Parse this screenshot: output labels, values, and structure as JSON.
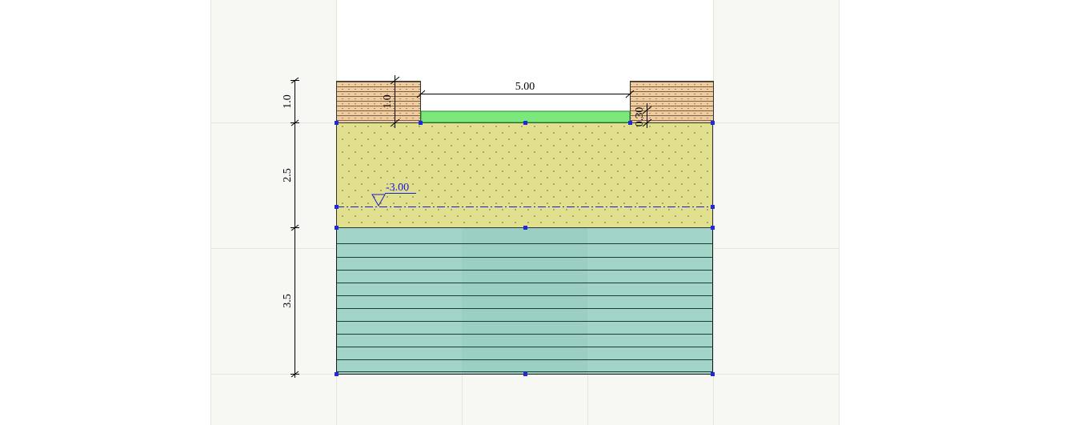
{
  "colors": {
    "page_bg": "#ffffff",
    "workspace_bg": "#f7f7f3",
    "grid_line": "#e6e6e0",
    "top_soil": "#f1cc9e",
    "middle_soil": "#e1e08e",
    "bottom_soil": "#a2d4c7",
    "water_in_trench": "#7be87b",
    "handle": "#1f2bd8",
    "water_table_line": "#1a1ad6"
  },
  "dimensions": {
    "trench_width": "5.00",
    "trench_depth": "1.0",
    "water_depth": "0.30"
  },
  "layer_thickness_labels": [
    "1.0",
    "2.5",
    "3.5"
  ],
  "water_table": {
    "label": "-3.00",
    "symbol": "water-table-triangle"
  }
}
